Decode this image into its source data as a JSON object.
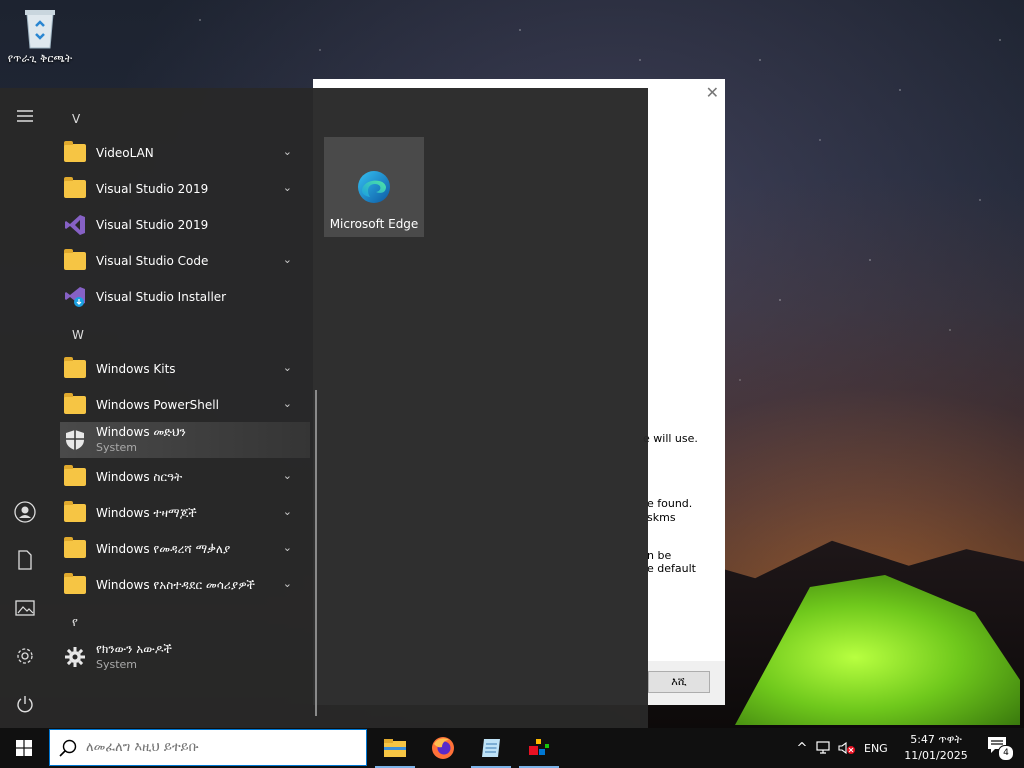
{
  "desktop": {
    "recycle_bin_label": "የጥራጊ ቅርጫት"
  },
  "dialog": {
    "fragment_1": "e will use.",
    "fragment_2": "e found.",
    "fragment_3": "skms",
    "fragment_4": "n be",
    "fragment_5": "e default",
    "ok_label": "እሺ"
  },
  "start_menu": {
    "sections": {
      "v": "V",
      "w": "W",
      "ye": "የ"
    },
    "apps": [
      {
        "label": "VideoLAN"
      },
      {
        "label": "Visual Studio 2019"
      },
      {
        "label": "Visual Studio 2019"
      },
      {
        "label": "Visual Studio Code"
      },
      {
        "label": "Visual Studio Installer"
      },
      {
        "label": "Windows Kits"
      },
      {
        "label": "Windows PowerShell"
      },
      {
        "label": "Windows መድህን",
        "sub": "System"
      },
      {
        "label": "Windows ስርዓት"
      },
      {
        "label": "Windows ተዛማጆች"
      },
      {
        "label": "Windows የመዳረሻ ማቃለያ"
      },
      {
        "label": "Windows የአስተዳደር መሳሪያዎች"
      },
      {
        "label": "የክንውን አውዶች",
        "sub": "System"
      }
    ],
    "tile": {
      "label": "Microsoft Edge"
    }
  },
  "taskbar": {
    "search_placeholder": "ለመፈለግ እዚህ ይተይቡ",
    "language": "ENG",
    "time": "5:47 ጥዋት",
    "date": "11/01/2025",
    "notification_count": "4"
  },
  "colors": {
    "accent": "#0078d4",
    "folder": "#f6c544",
    "start_bg": "#282828"
  }
}
